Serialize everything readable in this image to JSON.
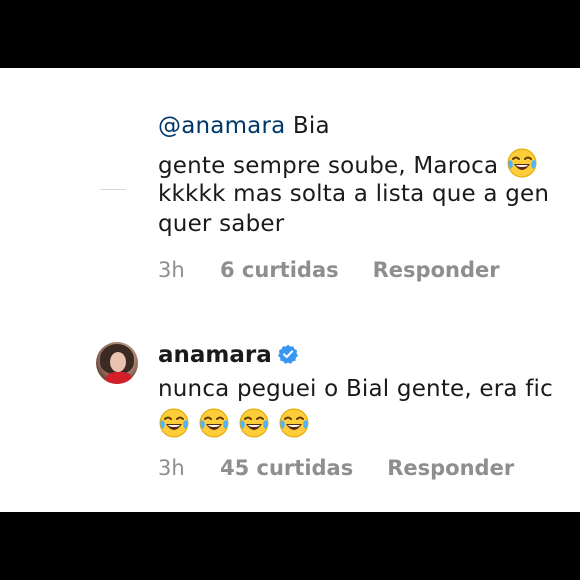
{
  "comment_reply": {
    "mention": "@anamara",
    "line1_rest": " Bia",
    "line2": "gente sempre soube, Maroca",
    "line3": "kkkkk mas solta a lista que a gen",
    "line4": "quer saber",
    "time": "3h",
    "likes": "6 curtidas",
    "reply_label": "Responder"
  },
  "comment_main": {
    "username": "anamara",
    "text": "nunca peguei o Bial gente, era fic",
    "time": "3h",
    "likes": "45 curtidas",
    "reply_label": "Responder"
  },
  "colors": {
    "mention": "#00376b",
    "meta": "#8e8e8e",
    "verified": "#3897f0",
    "background_bar": "#000000"
  },
  "icons": [
    "laughing-emoji-icon",
    "verified-badge-icon"
  ]
}
